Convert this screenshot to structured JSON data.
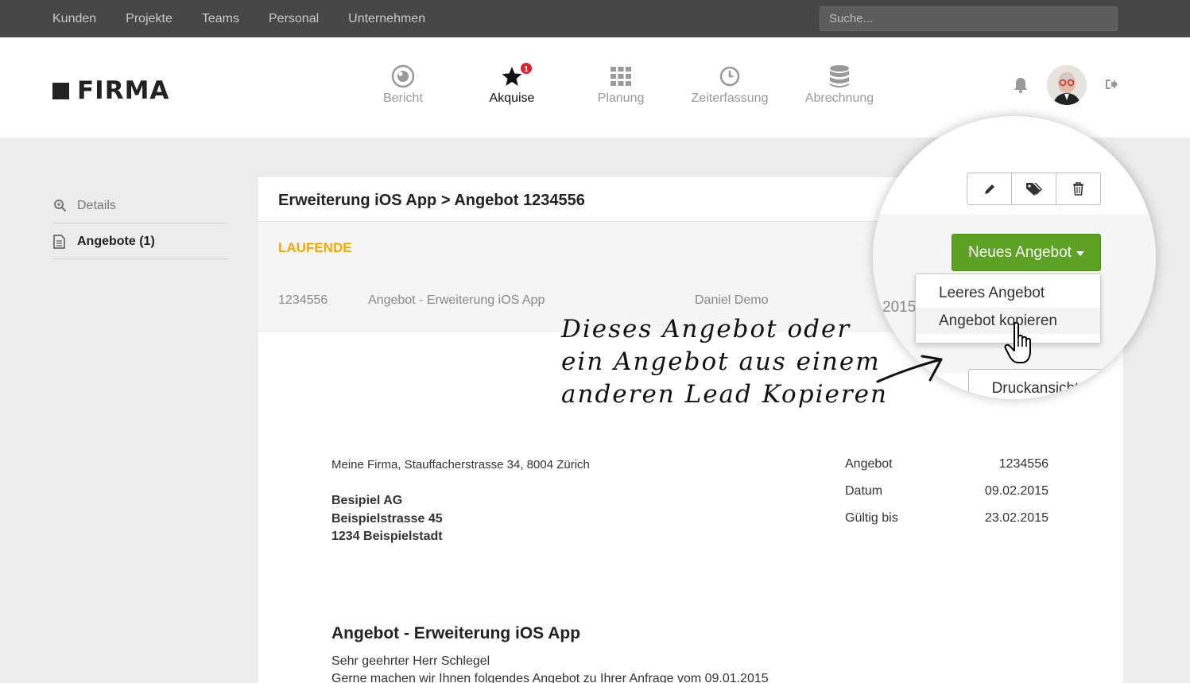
{
  "topnav": {
    "items": [
      "Kunden",
      "Projekte",
      "Teams",
      "Personal",
      "Unternehmen"
    ],
    "search_placeholder": "Suche..."
  },
  "header": {
    "logo_text": "FIRMA",
    "nav": [
      {
        "label": "Bericht",
        "icon": "eye-icon"
      },
      {
        "label": "Akquise",
        "icon": "star-icon",
        "badge": "1",
        "active": true
      },
      {
        "label": "Planung",
        "icon": "grid-icon"
      },
      {
        "label": "Zeiterfassung",
        "icon": "clock-icon"
      },
      {
        "label": "Abrechnung",
        "icon": "database-icon"
      }
    ]
  },
  "sidebar": {
    "items": [
      {
        "label": "Details",
        "icon": "magnifier-icon"
      },
      {
        "label": "Angebote (1)",
        "icon": "document-icon",
        "active": true
      }
    ]
  },
  "panel": {
    "title": "Erweiterung iOS App > Angebot 1234556",
    "section_label": "LAUFENDE",
    "row": {
      "number": "1234556",
      "name": "Angebot - Erweiterung iOS App",
      "owner": "Daniel Demo",
      "year": "2015"
    },
    "document": {
      "sender": "Meine Firma, Stauffacherstrasse 34, 8004 Zürich",
      "recipient": [
        "Besipiel AG",
        "Beispielstrasse 45",
        "1234 Beispielstadt"
      ],
      "meta": [
        {
          "label": "Angebot",
          "value": "1234556"
        },
        {
          "label": "Datum",
          "value": "09.02.2015"
        },
        {
          "label": "Gültig bis",
          "value": "23.02.2015"
        }
      ],
      "title": "Angebot - Erweiterung iOS App",
      "greeting": "Sehr geehrter Herr Schlegel",
      "intro": "Gerne machen wir Ihnen folgendes Angebot zu Ihrer Anfrage vom 09.01.2015"
    }
  },
  "magnifier": {
    "year": "2015",
    "new_offer_label": "Neues Angebot",
    "dropdown": [
      "Leeres Angebot",
      "Angebot kopieren"
    ],
    "print_label": "Druckansicht"
  },
  "annotation": {
    "lines": [
      "Dieses Angebot oder",
      "ein Angebot aus einem",
      "anderen Lead Kopieren"
    ]
  },
  "colors": {
    "accent_green": "#5da125",
    "section_orange": "#f5a800",
    "badge_red": "#e0202a",
    "topbar": "#474747"
  }
}
